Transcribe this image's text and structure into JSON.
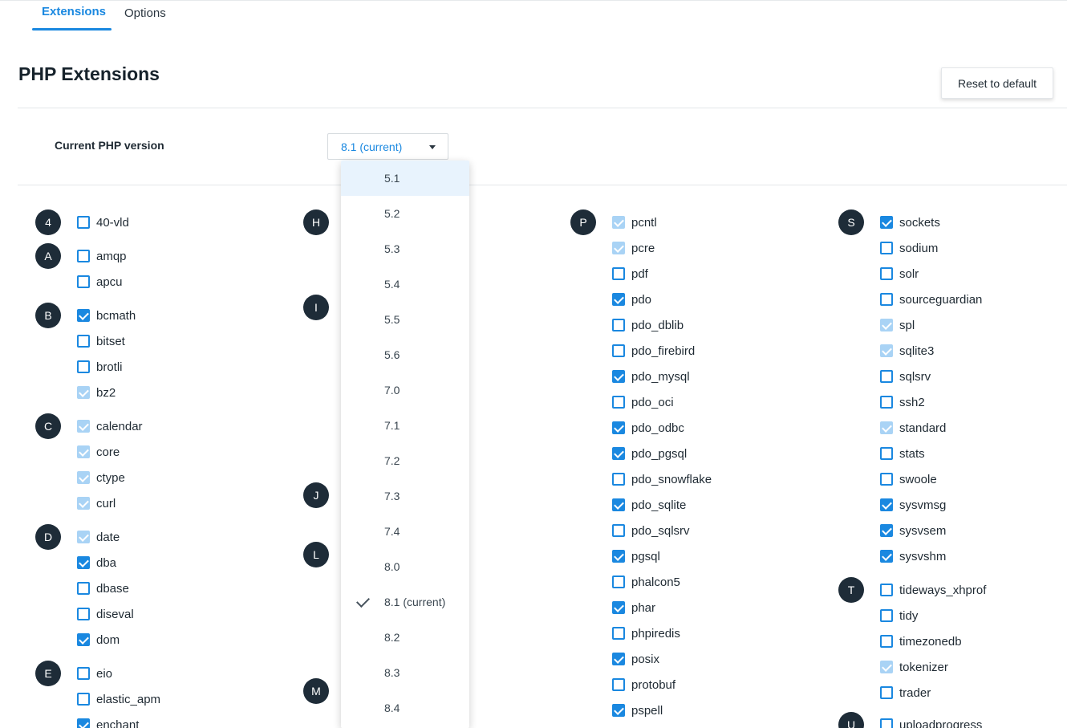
{
  "tabs": [
    {
      "label": "Extensions",
      "active": true
    },
    {
      "label": "Options",
      "active": false
    }
  ],
  "page_title": "PHP Extensions",
  "reset_button": "Reset to default",
  "version_selector": {
    "label": "Current PHP version",
    "selected": "8.1 (current)",
    "options": [
      "5.1",
      "5.2",
      "5.3",
      "5.4",
      "5.5",
      "5.6",
      "7.0",
      "7.1",
      "7.2",
      "7.3",
      "7.4",
      "8.0",
      "8.1 (current)",
      "8.2",
      "8.3",
      "8.4"
    ],
    "highlighted": "5.1",
    "checked": "8.1 (current)"
  },
  "colors": {
    "accent": "#1a88e0",
    "badge": "#1e2c38",
    "disabled_check": "#a9d3f5",
    "dropdown_highlight": "#e8f3fd"
  },
  "states_legend": {
    "on": "checked",
    "off": "unchecked",
    "dis": "checked-disabled"
  },
  "columns": [
    {
      "groups": [
        {
          "letter": "4",
          "items": [
            {
              "name": "40-vld",
              "state": "off"
            }
          ]
        },
        {
          "letter": "A",
          "items": [
            {
              "name": "amqp",
              "state": "off"
            },
            {
              "name": "apcu",
              "state": "off"
            }
          ]
        },
        {
          "letter": "B",
          "items": [
            {
              "name": "bcmath",
              "state": "on"
            },
            {
              "name": "bitset",
              "state": "off"
            },
            {
              "name": "brotli",
              "state": "off"
            },
            {
              "name": "bz2",
              "state": "dis"
            }
          ]
        },
        {
          "letter": "C",
          "items": [
            {
              "name": "calendar",
              "state": "dis"
            },
            {
              "name": "core",
              "state": "dis"
            },
            {
              "name": "ctype",
              "state": "dis"
            },
            {
              "name": "curl",
              "state": "dis"
            }
          ]
        },
        {
          "letter": "D",
          "items": [
            {
              "name": "date",
              "state": "dis"
            },
            {
              "name": "dba",
              "state": "on"
            },
            {
              "name": "dbase",
              "state": "off"
            },
            {
              "name": "diseval",
              "state": "off"
            },
            {
              "name": "dom",
              "state": "on"
            }
          ]
        },
        {
          "letter": "E",
          "items": [
            {
              "name": "eio",
              "state": "off"
            },
            {
              "name": "elastic_apm",
              "state": "off"
            },
            {
              "name": "enchant",
              "state": "on"
            }
          ]
        }
      ]
    },
    {
      "groups": [
        {
          "letter": "H",
          "items": []
        },
        {
          "letter": "I",
          "items": []
        },
        {
          "letter": "J",
          "items": []
        },
        {
          "letter": "L",
          "items": []
        },
        {
          "letter": "M",
          "items": []
        }
      ]
    },
    {
      "groups": [
        {
          "letter": "P",
          "items": [
            {
              "name": "pcntl",
              "state": "dis"
            },
            {
              "name": "pcre",
              "state": "dis"
            },
            {
              "name": "pdf",
              "state": "off"
            },
            {
              "name": "pdo",
              "state": "on"
            },
            {
              "name": "pdo_dblib",
              "state": "off"
            },
            {
              "name": "pdo_firebird",
              "state": "off"
            },
            {
              "name": "pdo_mysql",
              "state": "on"
            },
            {
              "name": "pdo_oci",
              "state": "off"
            },
            {
              "name": "pdo_odbc",
              "state": "on"
            },
            {
              "name": "pdo_pgsql",
              "state": "on"
            },
            {
              "name": "pdo_snowflake",
              "state": "off"
            },
            {
              "name": "pdo_sqlite",
              "state": "on"
            },
            {
              "name": "pdo_sqlsrv",
              "state": "off"
            },
            {
              "name": "pgsql",
              "state": "on"
            },
            {
              "name": "phalcon5",
              "state": "off"
            },
            {
              "name": "phar",
              "state": "on"
            },
            {
              "name": "phpiredis",
              "state": "off"
            },
            {
              "name": "posix",
              "state": "on"
            },
            {
              "name": "protobuf",
              "state": "off"
            },
            {
              "name": "pspell",
              "state": "on"
            }
          ]
        }
      ]
    },
    {
      "groups": [
        {
          "letter": "S",
          "items": [
            {
              "name": "sockets",
              "state": "on"
            },
            {
              "name": "sodium",
              "state": "off"
            },
            {
              "name": "solr",
              "state": "off"
            },
            {
              "name": "sourceguardian",
              "state": "off"
            },
            {
              "name": "spl",
              "state": "dis"
            },
            {
              "name": "sqlite3",
              "state": "dis"
            },
            {
              "name": "sqlsrv",
              "state": "off"
            },
            {
              "name": "ssh2",
              "state": "off"
            },
            {
              "name": "standard",
              "state": "dis"
            },
            {
              "name": "stats",
              "state": "off"
            },
            {
              "name": "swoole",
              "state": "off"
            },
            {
              "name": "sysvmsg",
              "state": "on"
            },
            {
              "name": "sysvsem",
              "state": "on"
            },
            {
              "name": "sysvshm",
              "state": "on"
            }
          ]
        },
        {
          "letter": "T",
          "items": [
            {
              "name": "tideways_xhprof",
              "state": "off"
            },
            {
              "name": "tidy",
              "state": "off"
            },
            {
              "name": "timezonedb",
              "state": "off"
            },
            {
              "name": "tokenizer",
              "state": "dis"
            },
            {
              "name": "trader",
              "state": "off"
            }
          ]
        },
        {
          "letter": "U",
          "items": [
            {
              "name": "uploadprogress",
              "state": "off"
            }
          ]
        }
      ]
    }
  ]
}
